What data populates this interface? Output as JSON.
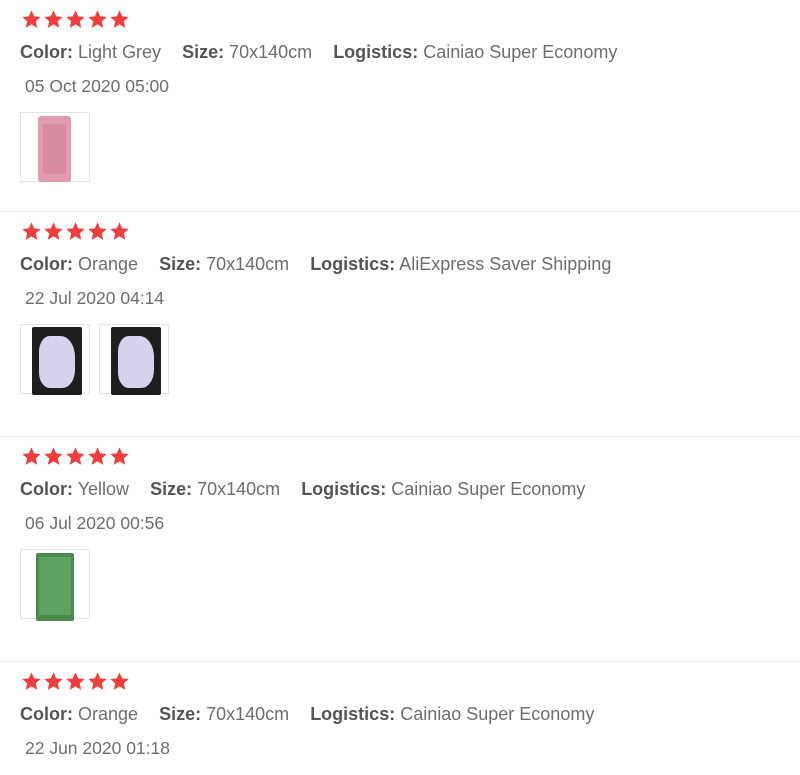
{
  "star_color": "#f03e3e",
  "labels": {
    "color": "Color:",
    "size": "Size:",
    "logistics": "Logistics:"
  },
  "reviews": [
    {
      "rating": 5,
      "color": "Light Grey",
      "size": "70x140cm",
      "logistics": "Cainiao Super Economy",
      "date": "05 Oct 2020 05:00",
      "photos": [
        "pink-towel-photo"
      ]
    },
    {
      "rating": 5,
      "color": "Orange",
      "size": "70x140cm",
      "logistics": "AliExpress Saver Shipping",
      "date": "22 Jul 2020 04:14",
      "photos": [
        "lavender-towel-photo",
        "lavender-towel-photo"
      ]
    },
    {
      "rating": 5,
      "color": "Yellow",
      "size": "70x140cm",
      "logistics": "Cainiao Super Economy",
      "date": "06 Jul 2020 00:56",
      "photos": [
        "green-towel-photo"
      ]
    },
    {
      "rating": 5,
      "color": "Orange",
      "size": "70x140cm",
      "logistics": "Cainiao Super Economy",
      "date": "22 Jun 2020 01:18",
      "photos": []
    }
  ]
}
